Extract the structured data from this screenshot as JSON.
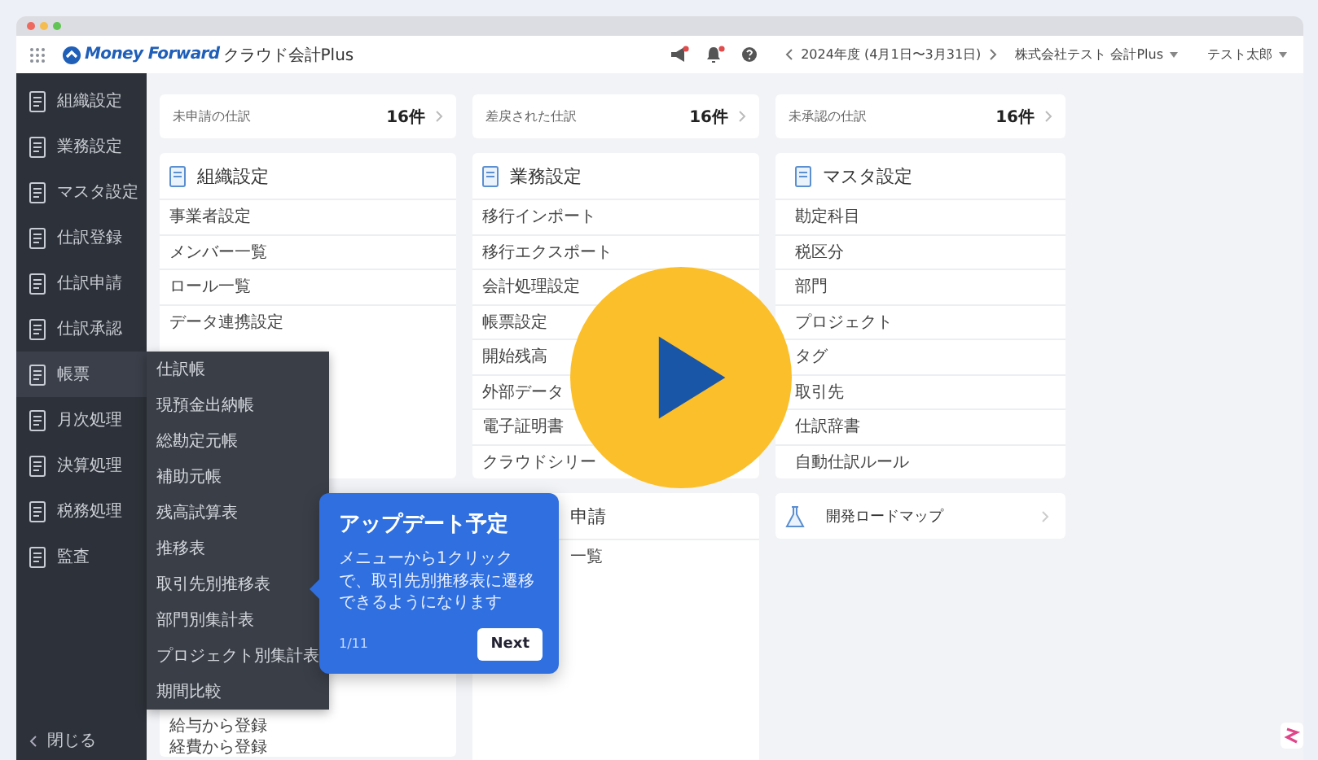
{
  "header": {
    "logo_brand": "Money Forward",
    "logo_product": "クラウド会計Plus",
    "icons": [
      {
        "kind": "megaphone",
        "badge": true
      },
      {
        "kind": "bell",
        "badge": true
      },
      {
        "kind": "help",
        "badge": false
      }
    ],
    "period": "2024年度 (4月1日〜3月31日)",
    "company": "株式会社テスト 会計Plus",
    "user": "テスト太郎"
  },
  "sidebar": {
    "items": [
      {
        "label": "組織設定",
        "expanded": false
      },
      {
        "label": "業務設定",
        "expanded": false
      },
      {
        "label": "マスタ設定",
        "expanded": false
      },
      {
        "label": "仕訳登録",
        "expanded": false
      },
      {
        "label": "仕訳申請",
        "expanded": false
      },
      {
        "label": "仕訳承認",
        "expanded": false
      },
      {
        "label": "帳票",
        "expanded": true,
        "children": [
          "仕訳帳",
          "現預金出納帳",
          "総勘定元帳",
          "補助元帳",
          "残高試算表",
          "推移表",
          "取引先別推移表",
          "部門別集計表",
          "プロジェクト別集計表",
          "期間比較"
        ]
      },
      {
        "label": "月次処理",
        "expanded": false
      },
      {
        "label": "決算処理",
        "expanded": false
      },
      {
        "label": "税務処理",
        "expanded": false
      },
      {
        "label": "監査",
        "expanded": false
      }
    ],
    "close": "閉じる"
  },
  "summary": [
    {
      "label": "未申請の仕訳",
      "count": "16件"
    },
    {
      "label": "差戻された仕訳",
      "count": "16件"
    },
    {
      "label": "未承認の仕訳",
      "count": "16件"
    }
  ],
  "sections": [
    {
      "title": "組織設定",
      "items": [
        "事業者設定",
        "メンバー一覧",
        "ロール一覧",
        "データ連携設定"
      ]
    },
    {
      "title": "業務設定",
      "items": [
        "移行インポート",
        "移行エクスポート",
        "会計処理設定",
        "帳票設定",
        "開始残高",
        "外部データ",
        "電子証明書",
        "クラウドシリー"
      ]
    },
    {
      "title": "マスタ設定",
      "items": [
        "勘定科目",
        "税区分",
        "部門",
        "プロジェクト",
        "タグ",
        "取引先",
        "仕訳辞書",
        "自動仕訳ルール"
      ]
    }
  ],
  "lower": [
    {
      "kind": "list",
      "items": [
        "給与から登録",
        "経費から登録"
      ]
    },
    {
      "kind": "list",
      "title": "申請",
      "items": [
        "一覧"
      ]
    },
    {
      "kind": "link",
      "title": "開発ロードマップ"
    }
  ],
  "popup": {
    "title": "アップデート予定",
    "body": "メニューから1クリックで、取引先別推移表に遷移できるようになります",
    "pager": "1/11",
    "button": "Next"
  }
}
